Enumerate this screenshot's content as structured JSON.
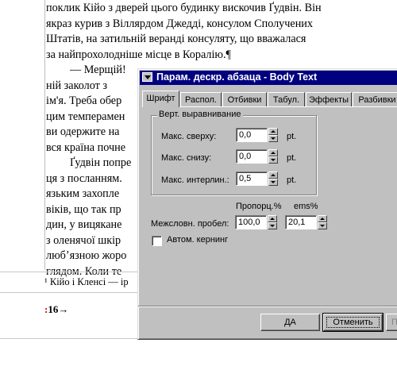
{
  "document": {
    "lines": [
      "поклик Кійо з дверей цього будинку вискочив Ґудвін. Він",
      "якраз курив з Віллярдом Джедді, консулом Сполучених",
      "Штатів, на затильній веранді консуляту, що вважалася",
      "за найпрохолодніше місце в Коралію.¶",
      "— Мерщій!",
      "ній заколот з",
      "ім'я. Треба обер",
      "цим темперамен",
      "ви одержите на",
      "вся країна почне",
      "Ґудвін попре",
      "ця з посланням.",
      "язьким захопле",
      "віків, що так пр",
      "дин, у вицякане",
      "з оленячої шкір",
      "любʼязною жоро",
      "глядом. Коли те"
    ],
    "footnote": "¹ Кійо і Кленсі — ір",
    "page_number": "16",
    "page_marker": "→"
  },
  "dialog": {
    "title": "Парам. дескр. абзаца - Body Text",
    "tabs": [
      "Шрифт",
      "Распол.",
      "Отбивки",
      "Табул.",
      "Эффекты",
      "Разбивки"
    ],
    "active_tab": "Шрифт",
    "group_title": "Верт. выравнивание",
    "fields": {
      "max_top": {
        "label": "Макс. сверху:",
        "value": "0,0",
        "unit": "pt."
      },
      "max_bottom": {
        "label": "Макс. снизу:",
        "value": "0,0",
        "unit": "pt."
      },
      "max_interline": {
        "label": "Макс. интерлин.:",
        "value": "0,5",
        "unit": "pt."
      }
    },
    "col_headers": {
      "proportional": "Пропорц.%",
      "ems": "ems%"
    },
    "word_spacing": {
      "label": "Межсловн. пробел:",
      "percent": "100,0",
      "ems": "20,1"
    },
    "auto_kerning": {
      "label": "Автом. кернинг",
      "checked": false
    },
    "buttons": {
      "ok": "ДА",
      "cancel": "Отменить",
      "third": "П"
    }
  }
}
